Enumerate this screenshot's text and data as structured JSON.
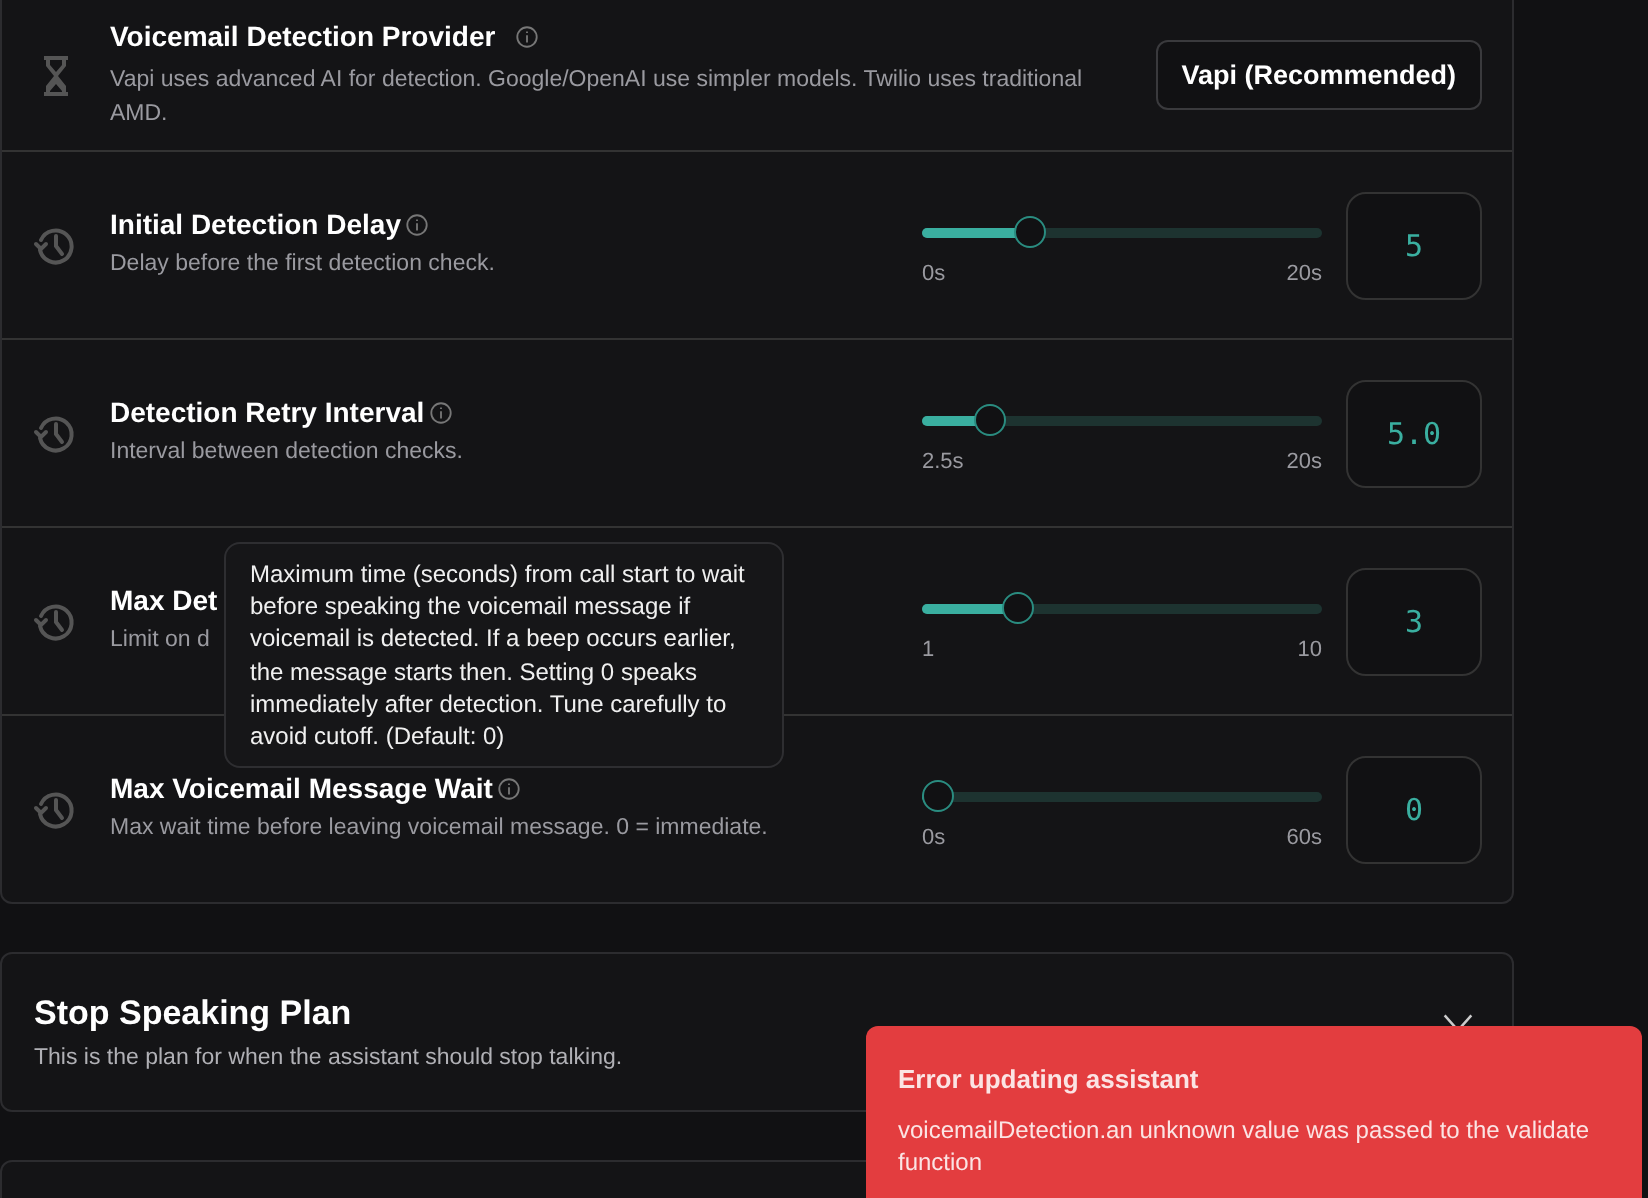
{
  "settings_panel": {
    "rows": [
      {
        "kind": "select",
        "title": "Voicemail Detection Provider",
        "info": true,
        "description": "Vapi uses advanced AI for detection. Google/OpenAI use simpler models. Twilio uses traditional AMD.",
        "value": "Vapi (Recommended)"
      },
      {
        "kind": "slider",
        "title": "Initial Detection Delay",
        "info": true,
        "description": "Delay before the first detection check.",
        "level": 0.25,
        "min_label": "0s",
        "max_label": "20s",
        "value": "5"
      },
      {
        "kind": "slider",
        "title": "Detection Retry Interval",
        "info": true,
        "description": "Interval between detection checks.",
        "level": 0.14,
        "min_label": "2.5s",
        "max_label": "20s",
        "value": "5.0"
      },
      {
        "kind": "slider",
        "title": "Max Det",
        "info": false,
        "description": "Limit on d",
        "level": 0.22,
        "min_label": "1",
        "max_label": "10",
        "value": "3"
      },
      {
        "kind": "slider",
        "title": "Max Voicemail Message Wait",
        "info": true,
        "description": "Max wait time before leaving voicemail message. 0 = immediate.",
        "level": 0,
        "min_label": "0s",
        "max_label": "60s",
        "value": "0"
      }
    ],
    "tooltip": "Maximum time (seconds) from call start to wait before speaking the voicemail message if voicemail is detected. If a beep occurs earlier, the message starts then. Setting 0 speaks immediately after detection. Tune carefully to avoid cutoff. (Default: 0)"
  },
  "stop_speaking_plan": {
    "title": "Stop Speaking Plan",
    "description": "This is the plan for when the assistant should stop talking.",
    "expanded": false
  },
  "toast": {
    "title": "Error updating assistant",
    "message": "voicemailDetection.an unknown value was passed to the validate function"
  }
}
